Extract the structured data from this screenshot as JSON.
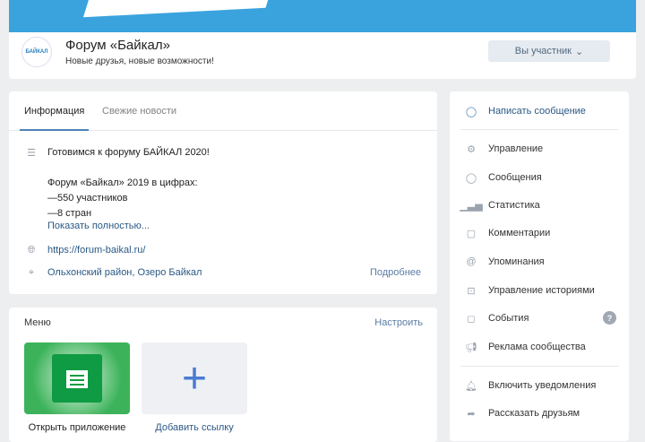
{
  "group": {
    "name": "Форум «Байкал»",
    "status": "Новые друзья, новые возможности!",
    "logo_text": "БАЙКАЛ",
    "member_button": "Вы участник"
  },
  "tabs": [
    {
      "label": "Информация"
    },
    {
      "label": "Свежие новости"
    }
  ],
  "info": {
    "description": [
      "Готовимся к форуму БАЙКАЛ 2020!",
      "",
      "Форум «Байкал» 2019 в цифрах:",
      "—550 участников",
      "—8 стран"
    ],
    "show_more": "Показать полностью...",
    "website": "https://forum-baikal.ru/",
    "location": "Ольхонский район, Озеро Байкал",
    "details": "Подробнее"
  },
  "menu": {
    "title": "Меню",
    "configure": "Настроить",
    "items": [
      {
        "label": "Открыть приложение"
      },
      {
        "label": "Добавить ссылку"
      }
    ]
  },
  "actions": {
    "write": "Написать сообщение",
    "items": [
      {
        "label": "Управление",
        "icon": "gear-icon"
      },
      {
        "label": "Сообщения",
        "icon": "message-icon"
      },
      {
        "label": "Статистика",
        "icon": "stats-icon"
      },
      {
        "label": "Комментарии",
        "icon": "comment-icon"
      },
      {
        "label": "Упоминания",
        "icon": "at-icon"
      },
      {
        "label": "Управление историями",
        "icon": "stories-icon"
      },
      {
        "label": "События",
        "icon": "events-icon",
        "badge": "?"
      },
      {
        "label": "Реклама сообщества",
        "icon": "megaphone-icon"
      }
    ],
    "notify": "Включить уведомления",
    "share": "Рассказать друзьям"
  },
  "colors": {
    "accent": "#5181b8",
    "cover": "#3aa3de"
  }
}
